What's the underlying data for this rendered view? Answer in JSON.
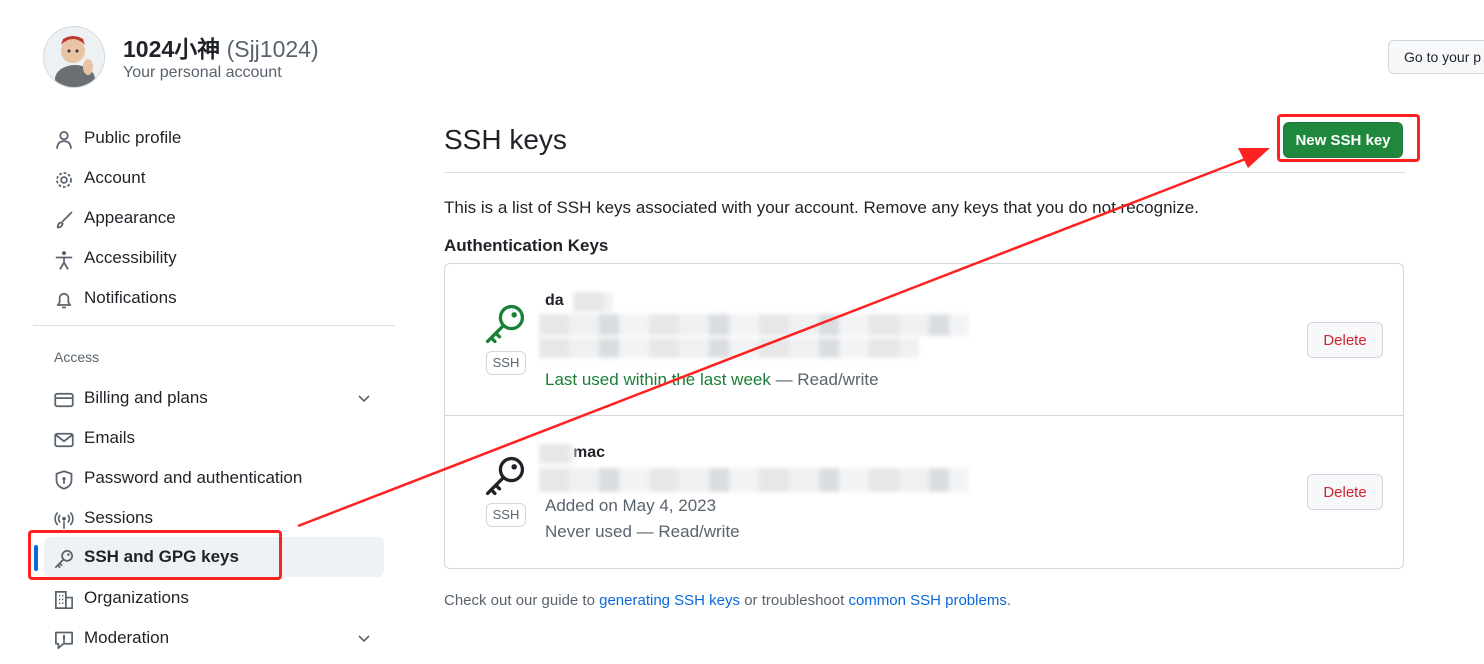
{
  "header": {
    "name": "1024小神",
    "login": "(Sjj1024)",
    "subtitle": "Your personal account",
    "go_to_label": "Go to your p"
  },
  "sidebar": {
    "items_top": [
      {
        "label": "Public profile",
        "icon": "person-icon"
      },
      {
        "label": "Account",
        "icon": "gear-icon"
      },
      {
        "label": "Appearance",
        "icon": "paintbrush-icon"
      },
      {
        "label": "Accessibility",
        "icon": "accessibility-icon"
      },
      {
        "label": "Notifications",
        "icon": "bell-icon"
      }
    ],
    "section_access": "Access",
    "items_access": [
      {
        "label": "Billing and plans",
        "icon": "credit-card-icon",
        "expandable": true
      },
      {
        "label": "Emails",
        "icon": "mail-icon"
      },
      {
        "label": "Password and authentication",
        "icon": "shield-lock-icon"
      },
      {
        "label": "Sessions",
        "icon": "broadcast-icon"
      },
      {
        "label": "SSH and GPG keys",
        "icon": "key-icon",
        "active": true
      },
      {
        "label": "Organizations",
        "icon": "organization-icon"
      },
      {
        "label": "Moderation",
        "icon": "report-icon",
        "expandable": true
      }
    ]
  },
  "main": {
    "title": "SSH keys",
    "new_key_button": "New SSH key",
    "intro": "This is a list of SSH keys associated with your account. Remove any keys that you do not recognize.",
    "auth_heading": "Authentication Keys",
    "keys": [
      {
        "title": "da",
        "badge": "SSH",
        "added": "",
        "last_used": "Last used within the last week",
        "access": " — Read/write",
        "icon_color": "#1a7f37",
        "delete_label": "Delete"
      },
      {
        "title": "mac",
        "badge": "SSH",
        "added": "Added on May 4, 2023",
        "last_used": "Never used",
        "access": " — Read/write",
        "icon_color": "#1f2328",
        "delete_label": "Delete"
      }
    ],
    "footer": {
      "prefix": "Check out our guide to ",
      "link1": "generating SSH keys",
      "middle": " or troubleshoot ",
      "link2": "common SSH problems",
      "suffix": "."
    }
  },
  "colors": {
    "primary_button": "#1f883d",
    "link": "#0969da",
    "danger": "#cf222e",
    "annotation": "#ff2020",
    "active_indicator": "#0969da"
  }
}
